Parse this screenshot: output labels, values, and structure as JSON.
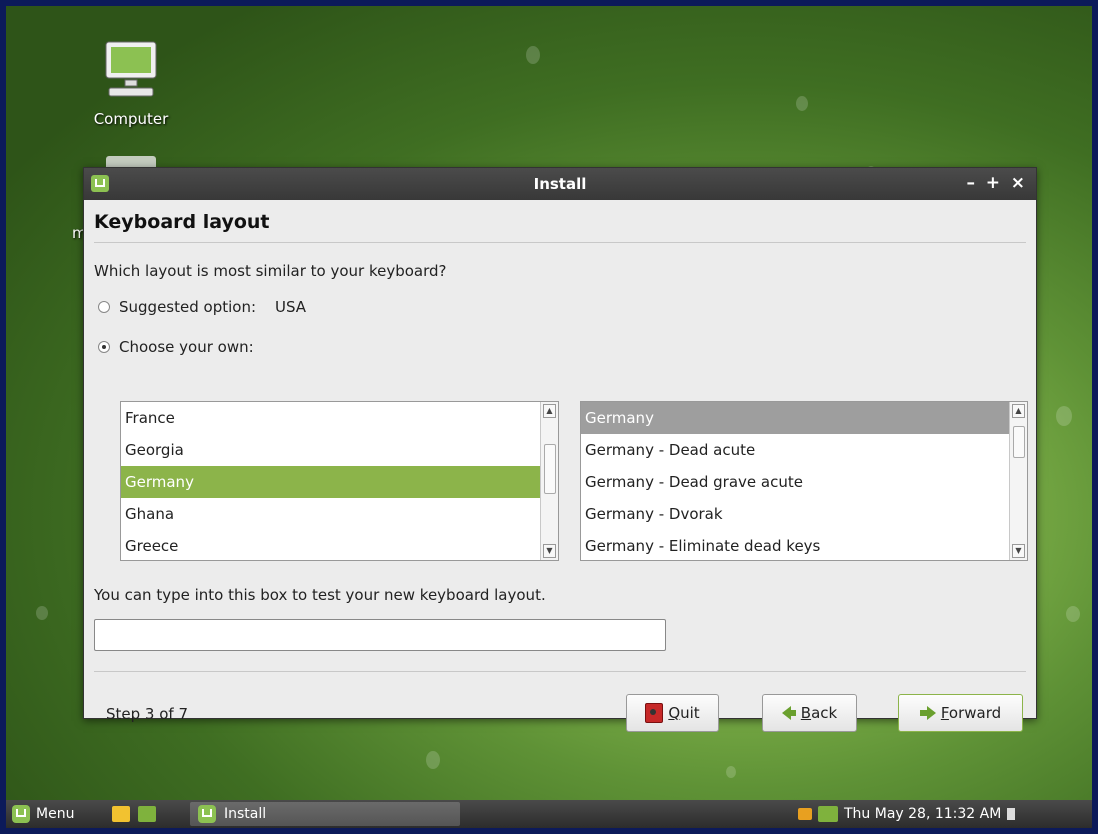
{
  "desktop": {
    "icons": [
      {
        "label": "Computer"
      }
    ],
    "partial_label": "m"
  },
  "window": {
    "title": "Install",
    "controls": {
      "minimize": "–",
      "maximize": "+",
      "close": "×"
    }
  },
  "page": {
    "heading": "Keyboard layout",
    "question": "Which layout is most similar to your keyboard?",
    "suggested_label": "Suggested option:",
    "suggested_value": "USA",
    "choose_label": "Choose your own:",
    "selected_option": "choose"
  },
  "layouts": {
    "items": [
      "France",
      "Georgia",
      "Germany",
      "Ghana",
      "Greece"
    ],
    "selected": "Germany"
  },
  "variants": {
    "items": [
      "Germany",
      "Germany - Dead acute",
      "Germany - Dead grave acute",
      "Germany - Dvorak",
      "Germany - Eliminate dead keys"
    ],
    "selected": "Germany"
  },
  "test": {
    "label": "You can type into this box to test your new keyboard layout.",
    "value": "",
    "placeholder": ""
  },
  "footer": {
    "step": "Step 3 of 7",
    "quit_mnemonic": "Q",
    "quit_rest": "uit",
    "back_mnemonic": "B",
    "back_rest": "ack",
    "forward_mnemonic": "F",
    "forward_rest": "orward"
  },
  "taskbar": {
    "menu_label": "Menu",
    "task_label": "Install",
    "clock": "Thu May 28, 11:32 AM"
  },
  "colors": {
    "accent_green": "#8cb44a",
    "title_bar": "#3f3f3f",
    "selection_gray": "#9e9e9e"
  }
}
